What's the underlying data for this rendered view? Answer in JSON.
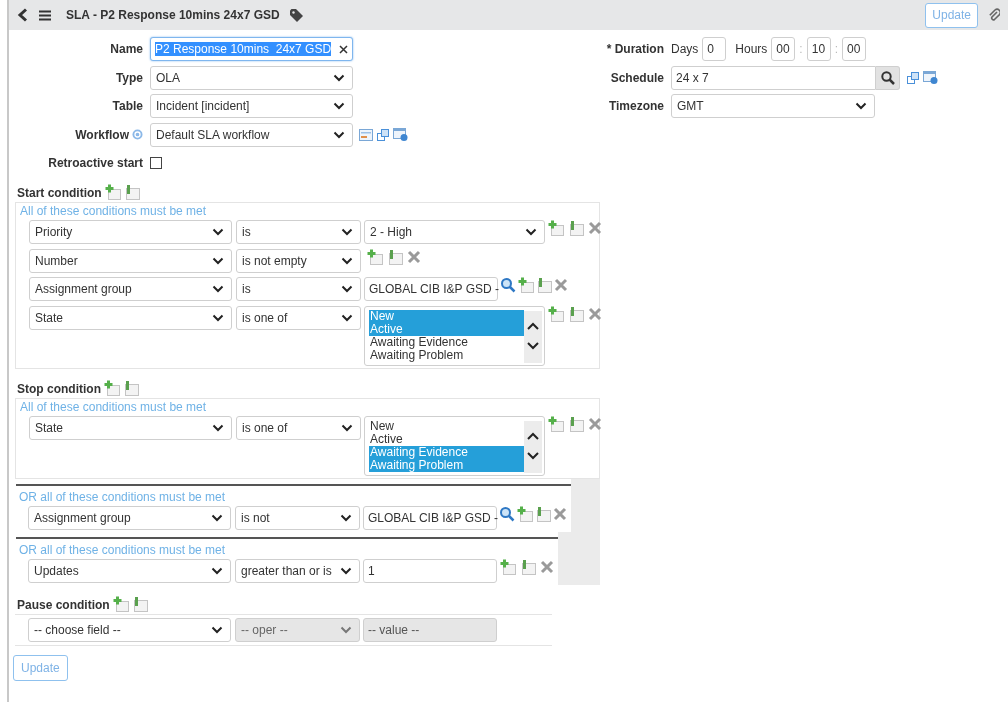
{
  "header": {
    "title": "SLA - P2 Response 10mins 24x7 GSD",
    "update_button": "Update"
  },
  "form": {
    "name": {
      "label": "Name",
      "value": "P2 Response 10mins  24x7 GSD",
      "text_selected": true
    },
    "type": {
      "label": "Type",
      "value": "OLA"
    },
    "table": {
      "label": "Table",
      "value": "Incident [incident]"
    },
    "workflow": {
      "label": "Workflow",
      "value": "Default SLA workflow"
    },
    "retroactive_start": {
      "label": "Retroactive start",
      "checked": false
    },
    "duration": {
      "label": "* Duration",
      "days_label": "Days",
      "days": "0",
      "hours_label": "Hours",
      "hours": "00",
      "separator_1": ":",
      "minutes": "10",
      "separator_2": ":",
      "seconds": "00"
    },
    "schedule": {
      "label": "Schedule",
      "value": "24 x 7"
    },
    "timezone": {
      "label": "Timezone",
      "value": "GMT"
    }
  },
  "conditions": [
    {
      "title": "Start condition",
      "groups": [
        {
          "kind": "all",
          "heading": "All of these conditions must be met",
          "rows": [
            {
              "kind": "select",
              "field": "Priority",
              "operator": "is",
              "operator_disabled": false,
              "value": "2 - High",
              "value_disabled": false,
              "actions": true
            },
            {
              "kind": "none",
              "field": "Number",
              "operator": "is not empty",
              "operator_disabled": false,
              "actions": true
            },
            {
              "kind": "reference",
              "field": "Assignment group",
              "operator": "is",
              "operator_disabled": false,
              "value": "GLOBAL CIB I&P GSD -",
              "value_disabled": false,
              "actions": true
            },
            {
              "kind": "list",
              "field": "State",
              "operator": "is one of",
              "operator_disabled": false,
              "actions": true,
              "options": [
                {
                  "label": "New",
                  "selected": true
                },
                {
                  "label": "Active",
                  "selected": true
                },
                {
                  "label": "Awaiting Evidence",
                  "selected": false
                },
                {
                  "label": "Awaiting Problem",
                  "selected": false
                }
              ]
            }
          ]
        }
      ]
    },
    {
      "title": "Stop condition",
      "groups": [
        {
          "kind": "all",
          "heading": "All of these conditions must be met",
          "rows": [
            {
              "kind": "list",
              "field": "State",
              "operator": "is one of",
              "operator_disabled": false,
              "actions": true,
              "options": [
                {
                  "label": "New",
                  "selected": false
                },
                {
                  "label": "Active",
                  "selected": false
                },
                {
                  "label": "Awaiting Evidence",
                  "selected": true
                },
                {
                  "label": "Awaiting Problem",
                  "selected": true
                }
              ]
            }
          ]
        },
        {
          "kind": "or",
          "heading": "OR all of these conditions must be met",
          "rows": [
            {
              "kind": "reference",
              "field": "Assignment group",
              "operator": "is not",
              "operator_disabled": false,
              "value": "GLOBAL CIB I&P GSD -",
              "value_disabled": false,
              "actions": true
            }
          ]
        },
        {
          "kind": "or",
          "heading": "OR all of these conditions must be met",
          "rows": [
            {
              "kind": "text",
              "field": "Updates",
              "operator": "greater than or is",
              "operator_disabled": false,
              "value": "1",
              "value_disabled": false,
              "actions": true
            }
          ]
        }
      ]
    },
    {
      "title": "Pause condition",
      "groups": [
        {
          "kind": "blank",
          "rows": [
            {
              "kind": "text",
              "field": "-- choose field --",
              "operator": "-- oper --",
              "operator_disabled": true,
              "value": "-- value --",
              "value_disabled": true,
              "actions": false
            }
          ]
        }
      ]
    }
  ],
  "footer": {
    "update_button": "Update"
  }
}
